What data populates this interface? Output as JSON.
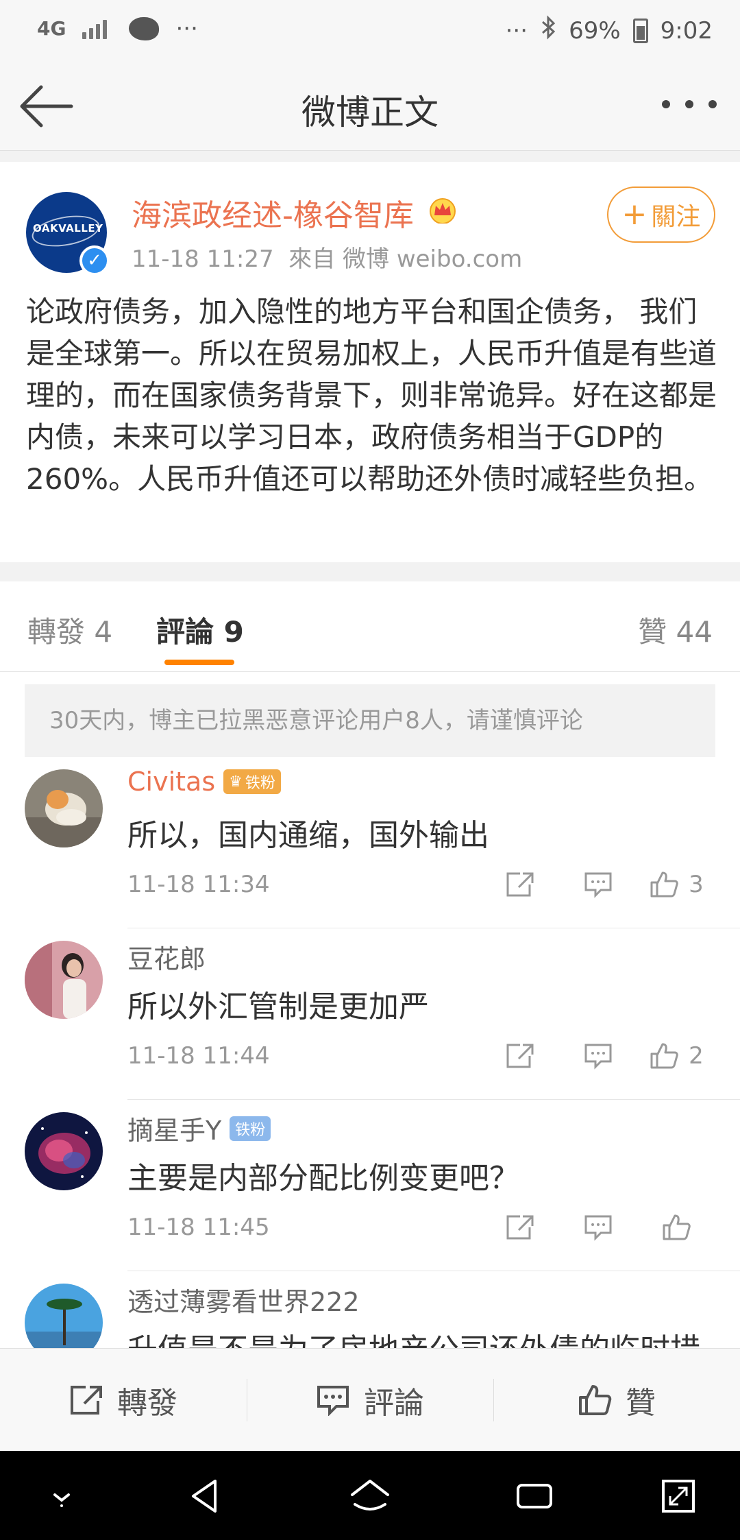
{
  "status_bar": {
    "network": "4G",
    "dots_left": "···",
    "dots_right": "···",
    "battery": "69%",
    "time": "9:02"
  },
  "header": {
    "title": "微博正文"
  },
  "post": {
    "author": "海滨政经述-橡谷智库",
    "avatar_text": "OAKVALLEY",
    "timestamp": "11-18 11:27",
    "source": "來自 微博 weibo.com",
    "follow_label": "關注",
    "text": "论政府债务，加入隐性的地方平台和国企债务， 我们是全球第一。所以在贸易加权上，人民币升值是有些道理的，而在国家债务背景下，则非常诡异。好在这都是内债，未来可以学习日本，政府债务相当于GDP的260%。人民币升值还可以帮助还外债时减轻些负担。"
  },
  "tabs": {
    "repost_label": "轉發 4",
    "comment_label": "評論 9",
    "like_label": "贊 44"
  },
  "notice": "30天内，博主已拉黑恶意评论用户8人，请谨慎评论",
  "comments": [
    {
      "user": "Civitas",
      "badge": "铁粉",
      "text": "所以，国内通缩，国外输出",
      "time": "11-18 11:34",
      "likes": "3"
    },
    {
      "user": "豆花郎",
      "badge": "",
      "text": "所以外汇管制是更加严",
      "time": "11-18 11:44",
      "likes": "2"
    },
    {
      "user": "摘星手Y",
      "badge": "铁粉",
      "text": "主要是内部分配比例变更吧？",
      "time": "11-18 11:45",
      "likes": ""
    },
    {
      "user": "透过薄雾看世界222",
      "badge": "",
      "text": "升值是不是为了房地产公司还外债的临时措",
      "time": "",
      "likes": ""
    }
  ],
  "action_bar": {
    "repost": "轉發",
    "comment": "評論",
    "like": "贊"
  },
  "colors": {
    "accent_orange": "#eb7350",
    "follow_orange": "#f29c38",
    "tab_indicator": "#ff8200",
    "verified_blue": "#2d8ff0"
  }
}
